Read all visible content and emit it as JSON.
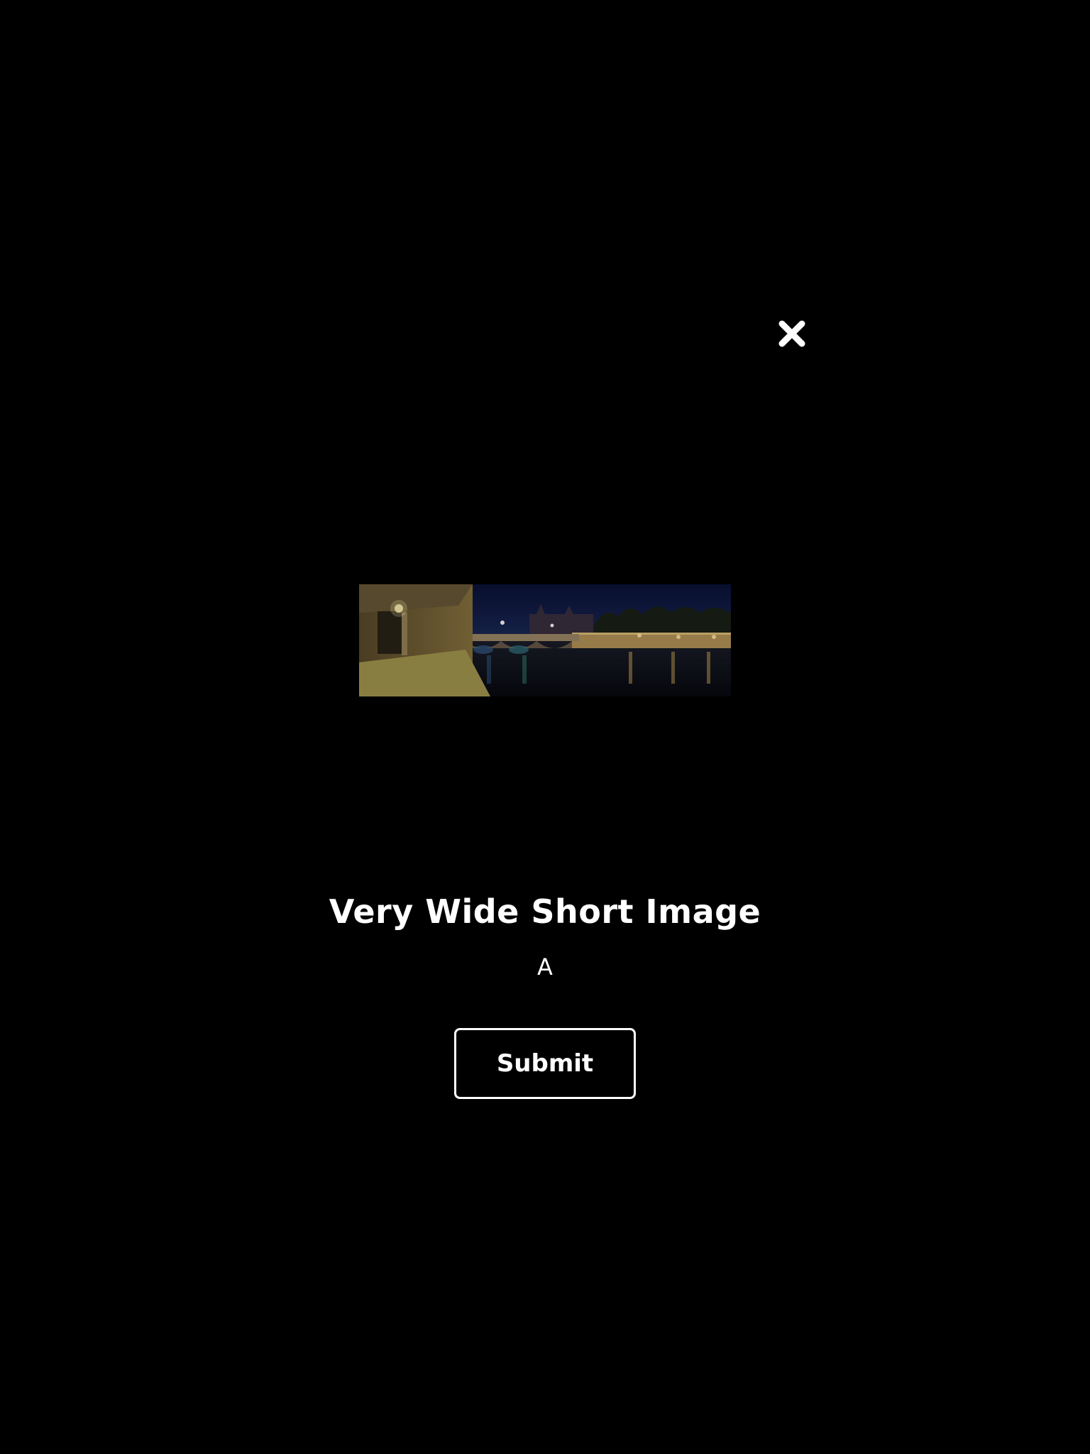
{
  "dialog": {
    "close_icon": "close-icon",
    "image": {
      "description_icon": "panorama-night-bridge-photo",
      "colors": {
        "sky": "#0d1640",
        "water": "#0a0f1a",
        "warm_light": "#c9a24a"
      }
    },
    "title": "Very Wide Short Image",
    "subtitle": "A",
    "submit_label": "Submit"
  },
  "colors": {
    "background": "#000000",
    "foreground": "#ffffff"
  }
}
